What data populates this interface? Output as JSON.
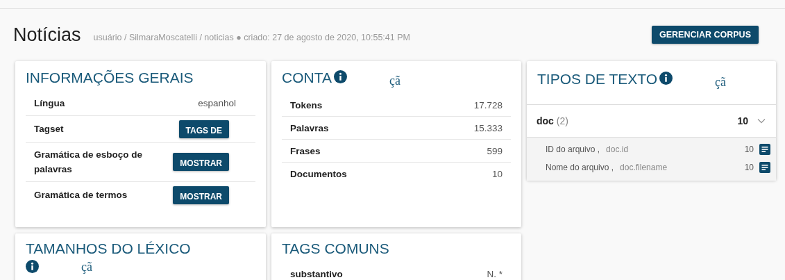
{
  "header": {
    "title": "Notícias",
    "path": "usuário / SilmaraMoscatelli / noticias ● criado: 27 de agosto de 2020, 10:55:41 PM",
    "button": "GERENCIAR CORPUS"
  },
  "general": {
    "title": "INFORMAÇÕES GERAIS",
    "rows": [
      {
        "kind": "text",
        "label": "Língua",
        "value": "espanhol"
      },
      {
        "kind": "button",
        "label": "Tagset",
        "value": "TAGS DE"
      },
      {
        "kind": "button",
        "label": "Gramática de esboço de palavras",
        "value": "MOSTRAR"
      },
      {
        "kind": "button",
        "label": "Gramática de termos",
        "value": "MOSTRAR"
      }
    ]
  },
  "count": {
    "title": "CONTA",
    "info_text": "çã",
    "rows": [
      {
        "label": "Tokens",
        "value": "17.728"
      },
      {
        "label": "Palavras",
        "value": "15.333"
      },
      {
        "label": "Frases",
        "value": "599"
      },
      {
        "label": "Documentos",
        "value": "10"
      }
    ]
  },
  "text_types": {
    "title": "TIPOS DE TEXTO",
    "info_text": "çã",
    "group": {
      "name": "doc",
      "count": "(2)",
      "total": "10",
      "expanded": true,
      "items": [
        {
          "label": "ID do arquivo ,",
          "attribute": "doc.id",
          "value": "10"
        },
        {
          "label": "Nome do arquivo ,",
          "attribute": "doc.filename",
          "value": "10"
        }
      ]
    }
  },
  "lexicon": {
    "title": "TAMANHOS DO LÉXICO",
    "info_text": "çã"
  },
  "common_tags": {
    "title": "TAGS COMUNS",
    "rows": [
      {
        "label": "substantivo",
        "value": "N. *"
      }
    ]
  }
}
